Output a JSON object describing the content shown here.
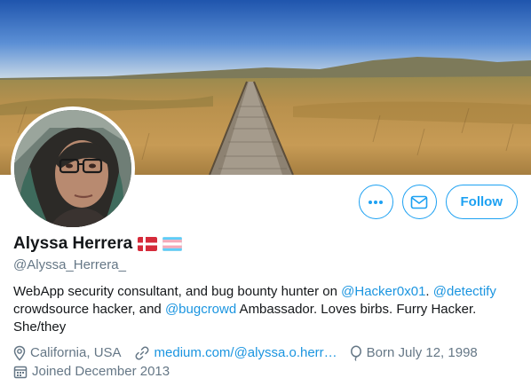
{
  "profile": {
    "name": "Alyssa Herrera",
    "handle": "@Alyssa_Herrera_",
    "bio": {
      "part1": "WebApp security consultant, and bug bounty hunter on ",
      "mention1": "@Hacker0x01",
      "part2": ". ",
      "mention2": "@detectify",
      "part3": " crowdsource hacker, and ",
      "mention3": "@bugcrowd",
      "part4": " Ambassador. Loves birbs. Furry Hacker. She/they"
    },
    "location": "California, USA",
    "website": "medium.com/@alyssa.o.herr…",
    "birthday": "Born July 12, 1998",
    "joined": "Joined December 2013"
  },
  "actions": {
    "follow_label": "Follow",
    "more_icon": "more-icon",
    "message_icon": "mail-icon"
  },
  "flags": [
    "denmark-flag",
    "transgender-flag"
  ],
  "colors": {
    "accent": "#1da1f2",
    "link": "#1b95e0",
    "secondary_text": "#657786",
    "primary_text": "#14171a"
  }
}
